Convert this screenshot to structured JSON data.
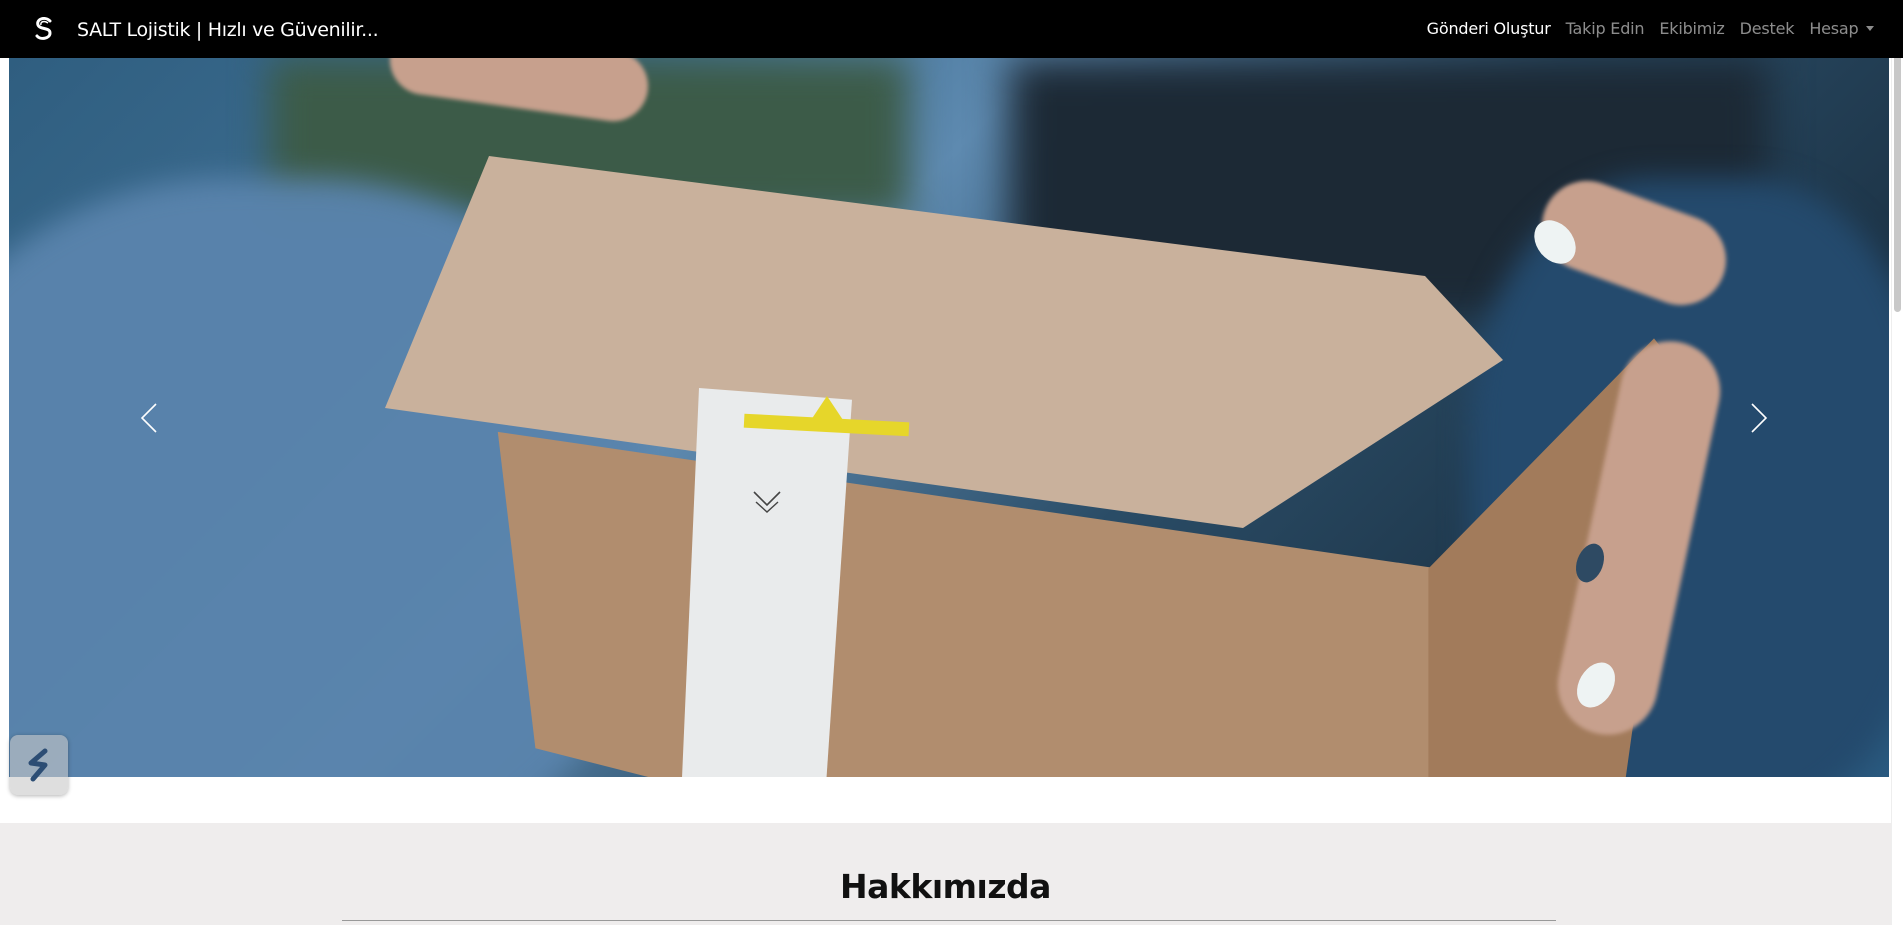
{
  "navbar": {
    "brand_title": "SALT Lojistik | Hızlı ve Güvenilir...",
    "links": {
      "create_shipment": "Gönderi Oluştur",
      "track": "Takip Edin",
      "team": "Ekibimiz",
      "support": "Destek",
      "account": "Hesap"
    }
  },
  "hero": {
    "slide_description": "delivery box handed over",
    "prev_icon": "chevron-left-icon",
    "next_icon": "chevron-right-icon",
    "scroll_icon": "chevron-down-icon"
  },
  "about": {
    "title": "Hakkımızda"
  },
  "colors": {
    "navbar_bg": "#000000",
    "nav_active": "#ffffff",
    "nav_inactive": "#8c8c8c",
    "about_bg": "#efeded"
  }
}
